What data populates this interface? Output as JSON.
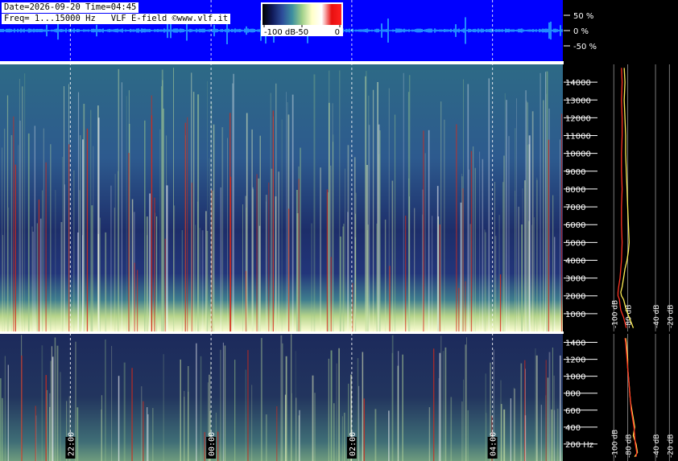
{
  "header": {
    "line1": "Date=2026-09-20 Time=04:45",
    "line2": "Freq= 1...15000 Hz   VLF E-field ©www.vlf.it"
  },
  "colors": {
    "scale_bg": "#0000ff",
    "wave": "#39e6ff",
    "series_level": "#ffee55",
    "series_avg": "#ff3322"
  },
  "colorbar": {
    "ticks": [
      "-100 dB",
      "-50",
      "0"
    ],
    "stops": [
      "#000000",
      "#101a5a",
      "#2d4d9a",
      "#3d8fa0",
      "#9ecf8a",
      "#ffffc8",
      "#ffffff",
      "#e81010",
      "#ff2020"
    ]
  },
  "chart_data": [
    {
      "type": "line",
      "panel": "waveform",
      "y_unit": "%",
      "ylim": [
        -100,
        100
      ],
      "ytick_labels": [
        "50 %",
        "0 %",
        "-50 %"
      ],
      "yticks": [
        50,
        0,
        -50
      ]
    },
    {
      "type": "heatmap",
      "panel": "spectrogram-wideband",
      "ylim": [
        0,
        15000
      ],
      "yticks": [
        1000,
        2000,
        3000,
        4000,
        5000,
        6000,
        7000,
        8000,
        9000,
        10000,
        11000,
        12000,
        13000,
        14000
      ],
      "ytick_labels": [
        "1000",
        "2000",
        "3000",
        "4000",
        "5000",
        "6000",
        "7000",
        "8000",
        "9000",
        "10000",
        "11000",
        "12000",
        "13000",
        "14000"
      ],
      "x_ticks": [
        "22:00",
        "00:00",
        "02:00",
        "04:00"
      ],
      "x_tick_positions": [
        0.125,
        0.375,
        0.625,
        0.875
      ],
      "value_range_db": [
        -100,
        0
      ]
    },
    {
      "type": "heatmap",
      "panel": "spectrogram-lowband",
      "ylim": [
        0,
        1500
      ],
      "yticks": [
        200,
        400,
        600,
        800,
        1000,
        1200,
        1400
      ],
      "ytick_labels": [
        "200 Hz",
        "400",
        "600",
        "800",
        "1000",
        "1200",
        "1400"
      ],
      "x_ticks": [
        "22:00",
        "00:00",
        "02:00",
        "04:00"
      ],
      "x_tick_positions": [
        0.125,
        0.375,
        0.625,
        0.875
      ],
      "value_range_db": [
        -100,
        0
      ]
    },
    {
      "type": "line",
      "panel": "spectrum-wideband",
      "x_unit": "dB",
      "xlim": [
        -120,
        -10
      ],
      "xticks": [
        -100,
        -80,
        -40,
        -20
      ],
      "xtick_labels": [
        "-100 dB",
        "-80 dB",
        "-40 dB",
        "-20 dB"
      ],
      "series": [
        {
          "color_key": "series_level",
          "freq_hz": [
            14800,
            14000,
            13000,
            12000,
            11000,
            10000,
            9000,
            8000,
            7000,
            6000,
            5000,
            4500,
            4000,
            3500,
            3000,
            2500,
            2200,
            2000,
            1800,
            1500,
            1200,
            1000,
            800,
            500,
            200
          ],
          "db": [
            -85,
            -84,
            -85,
            -84,
            -83,
            -83,
            -82,
            -81,
            -80,
            -79,
            -78,
            -79,
            -81,
            -84,
            -86,
            -88,
            -90,
            -89,
            -86,
            -84,
            -82,
            -80,
            -78,
            -75,
            -72
          ]
        },
        {
          "color_key": "series_avg",
          "freq_hz": [
            14800,
            14000,
            13000,
            12000,
            11000,
            10000,
            9000,
            8000,
            7000,
            6000,
            5000,
            4000,
            3500,
            3000,
            2500,
            2200,
            2000,
            1800,
            1500,
            1200,
            1000,
            800,
            500,
            200
          ],
          "db": [
            -89,
            -88,
            -89,
            -88,
            -88,
            -89,
            -89,
            -88,
            -89,
            -89,
            -88,
            -89,
            -90,
            -91,
            -93,
            -94,
            -94,
            -92,
            -91,
            -90,
            -88,
            -86,
            -84,
            -82
          ]
        }
      ]
    },
    {
      "type": "line",
      "panel": "spectrum-lowband",
      "x_unit": "dB",
      "xlim": [
        -120,
        -10
      ],
      "xticks": [
        -100,
        -80,
        -40,
        -20
      ],
      "xtick_labels": [
        "-100 dB",
        "-80 dB",
        "-40 dB",
        "-20 dB"
      ],
      "series": [
        {
          "color_key": "series_level",
          "freq_hz": [
            1450,
            1400,
            1300,
            1200,
            1100,
            1000,
            900,
            800,
            700,
            600,
            500,
            400,
            300,
            200,
            100,
            50
          ],
          "db": [
            -83,
            -82,
            -81,
            -80,
            -80,
            -79,
            -78,
            -77,
            -76,
            -74,
            -72,
            -70,
            -72,
            -68,
            -66,
            -70
          ]
        },
        {
          "color_key": "series_avg",
          "freq_hz": [
            1450,
            1400,
            1300,
            1200,
            1100,
            1000,
            900,
            800,
            700,
            600,
            500,
            400,
            300,
            200,
            100,
            50
          ],
          "db": [
            -84,
            -83,
            -82,
            -81,
            -80,
            -79,
            -78,
            -77,
            -76,
            -75,
            -73,
            -71,
            -70,
            -69,
            -67,
            -68
          ]
        }
      ]
    }
  ]
}
